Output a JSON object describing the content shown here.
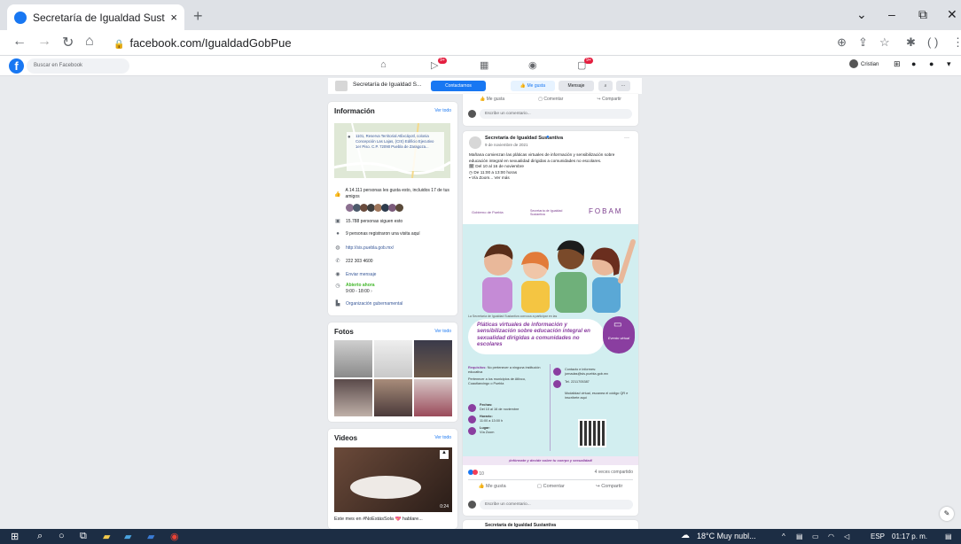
{
  "browser": {
    "tab_title": "Secretaría de Igualdad Sustantiv",
    "tab_close": "×",
    "new_tab": "+",
    "url": "facebook.com/IgualdadGobPue",
    "window_controls": [
      "⌄",
      "–",
      "⧉",
      "✕"
    ]
  },
  "facebook": {
    "search_placeholder": "Buscar en Facebook",
    "badges": [
      "9+",
      "9+"
    ],
    "user_name": "Cristian"
  },
  "page_header": {
    "name": "Secretaría de Igualdad S...",
    "contact_button": "Contactarnos",
    "like_button": "Me gusta",
    "message_button": "Mensaje"
  },
  "info_card": {
    "title": "Información",
    "see_all": "Ver todo",
    "address": "1101, Reserva Territorial Atlixcáyotl, colonia Concepción Las Lajas, (CIS) Edificio Ejecutivo 1er Piso. C.P. 72090 Puebla de Zaragoza...",
    "likes": "A 14.111 personas les gusta esto, incluidos 17 de tus amigos",
    "followers": "15.788 personas siguen esto",
    "checkins": "9 personas registraron una visita aquí",
    "website": "http://sis.puebla.gob.mx/",
    "phone": "222 303 4600",
    "send_message": "Enviar mensaje",
    "open_now": "Abierto ahora",
    "hours": "9:00 - 18:00",
    "category": "Organización gubernamental"
  },
  "photos_card": {
    "title": "Fotos",
    "see_all": "Ver todo"
  },
  "videos_card": {
    "title": "Videos",
    "see_all": "Ver todo",
    "video_duration": "0:24",
    "caption": "Este mes en #NoEstásSola 💖 hablare..."
  },
  "top_post": {
    "like": "Me gusta",
    "comment": "Comentar",
    "share": "Compartir",
    "comment_placeholder": "Escribe un comentario..."
  },
  "post": {
    "author": "Secretaría de Igualdad Sustantiva",
    "date": "9 de noviembre de 2021",
    "text": "Mañana comienzan las pláticas virtuales de información y sensibilización sobre educación integral en sexualidad dirigidas a comunidades no escolares.",
    "line_dates": "Del 10 al 16 de noviembre",
    "line_time": "De 11:00 a 13:00 horas",
    "line_via": "Vía Zoom... Ver más",
    "reactions_count": "10",
    "shares": "4 veces compartido",
    "like": "Me gusta",
    "comment": "Comentar",
    "share": "Compartir",
    "comment_placeholder": "Escribe un comentario...",
    "next_author": "Secretaría de Igualdad Sustantiva"
  },
  "poster": {
    "logo_left": "Gobierno de Puebla",
    "logo_mid": "Secretaría de Igualdad Sustantiva",
    "logo_right": "FOBAM",
    "intro": "La Secretaría de Igualdad Sustantiva convoca a participar en las",
    "headline": "Pláticas virtuales de información y sensibilización sobre educación integral en sexualidad dirigidas a comunidades no escolares",
    "badge": "Evento virtual",
    "req_label": "Requisitos:",
    "req_text": "No pertenecer a ninguna institución educativa",
    "req2": "Pertenecer a los municipios de Atlixco, Cuautlancingo o Puebla",
    "fechas_label": "Fechas:",
    "fechas": "Del 10 al 16 de noviembre",
    "horario_label": "Horario:",
    "horario": "11:00 a 13:00 h",
    "lugar_label": "Lugar:",
    "lugar": "Vía Zoom",
    "contact": "Contacto e informes: jornadas@sis.puebla.gob.mx",
    "tel": "Tel. 2211705387",
    "modalidad": "Modalidad virtual, escanea el código QR e inscríbete aquí",
    "footer": "¡Infórmate y decide sobre tu cuerpo y sexualidad!"
  },
  "taskbar": {
    "weather": "18°C  Muy nubl...",
    "lang": "ESP",
    "time": "01:17 p. m."
  },
  "colors": {
    "fb_blue": "#1877f2",
    "poster_purple": "#8a3ea0",
    "poster_teal": "#d2eef0"
  }
}
